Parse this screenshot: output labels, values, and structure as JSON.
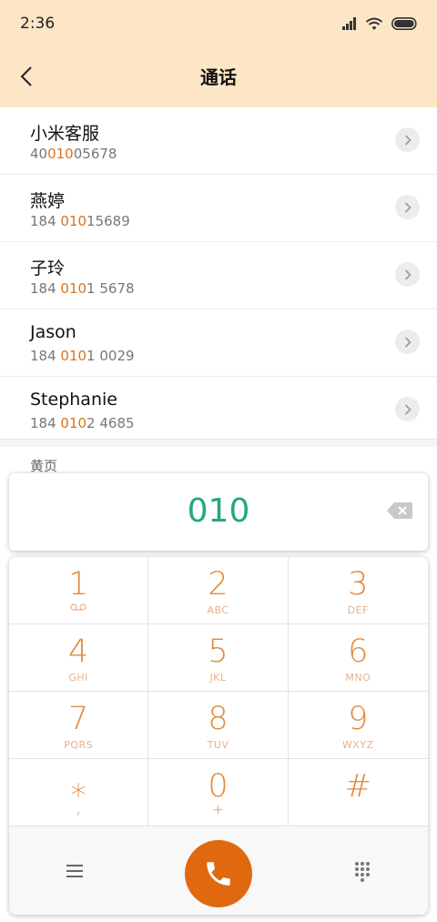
{
  "status_bar": {
    "time": "2:36"
  },
  "header": {
    "title": "通话"
  },
  "contacts": [
    {
      "name": "小米客服",
      "number_pre": "40",
      "number_match": "010",
      "number_post": "05678"
    },
    {
      "name": "燕婷",
      "number_pre": "184 ",
      "number_match": "010",
      "number_post": "15689"
    },
    {
      "name": "子玲",
      "number_pre": "184 ",
      "number_match": "010",
      "number_post": "1 5678"
    },
    {
      "name": "Jason",
      "number_pre": "184 ",
      "number_match": "010",
      "number_post": "1 0029"
    },
    {
      "name": "Stephanie",
      "number_pre": "184 ",
      "number_match": "010",
      "number_post": "2 4685"
    }
  ],
  "section": {
    "label": "黄页"
  },
  "dialer": {
    "input": "010"
  },
  "keypad": {
    "keys": [
      {
        "digit": "1",
        "letters": ""
      },
      {
        "digit": "2",
        "letters": "ABC"
      },
      {
        "digit": "3",
        "letters": "DEF"
      },
      {
        "digit": "4",
        "letters": "GHI"
      },
      {
        "digit": "5",
        "letters": "JKL"
      },
      {
        "digit": "6",
        "letters": "MNO"
      },
      {
        "digit": "7",
        "letters": "PQRS"
      },
      {
        "digit": "8",
        "letters": "TUV"
      },
      {
        "digit": "9",
        "letters": "WXYZ"
      },
      {
        "digit": "⁎",
        "letters": ","
      },
      {
        "digit": "0",
        "letters": "+"
      },
      {
        "digit": "#",
        "letters": ""
      }
    ]
  },
  "colors": {
    "accent": "#e0690f",
    "highlight": "#d9731a",
    "dial_text": "#22a87a",
    "header_bg": "#fde6c6"
  }
}
